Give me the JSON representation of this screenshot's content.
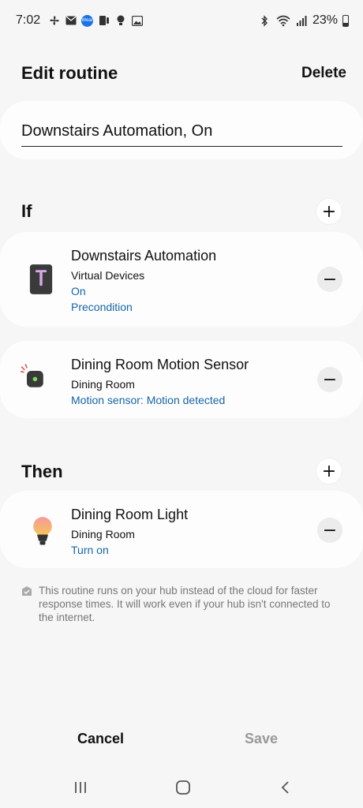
{
  "status_bar": {
    "time": "7:02",
    "battery": "23%",
    "wear_label": "Wear",
    "left_icons": [
      "fan-icon",
      "mail-icon",
      "wear-icon",
      "smartthings-icon",
      "bulb-icon",
      "image-icon"
    ],
    "right_icons": [
      "bluetooth-icon",
      "wifi-icon",
      "signal-icon",
      "battery-icon"
    ]
  },
  "header": {
    "title": "Edit routine",
    "delete_label": "Delete"
  },
  "routine_name": {
    "value": "Downstairs Automation, On"
  },
  "if_section": {
    "title": "If",
    "add_symbol": "+",
    "conditions": [
      {
        "title": "Downstairs Automation",
        "room": "Virtual Devices",
        "state": "On",
        "extra": "Precondition",
        "icon": "virtual-switch-icon",
        "remove_symbol": "−"
      },
      {
        "title": "Dining Room Motion Sensor",
        "room": "Dining Room",
        "state": "Motion sensor: Motion detected",
        "icon": "motion-sensor-icon",
        "remove_symbol": "−"
      }
    ]
  },
  "then_section": {
    "title": "Then",
    "add_symbol": "+",
    "actions": [
      {
        "title": "Dining Room Light",
        "room": "Dining Room",
        "state": "Turn on",
        "icon": "light-bulb-icon",
        "remove_symbol": "−"
      }
    ]
  },
  "info_note": "This routine runs on your hub instead of the cloud for faster response times. It will work even if your hub isn't connected to the internet.",
  "footer": {
    "cancel_label": "Cancel",
    "save_label": "Save"
  },
  "colors": {
    "background": "#f6f6f6",
    "card": "#fdfdfd",
    "link": "#1565a8",
    "muted": "#777777",
    "disabled": "#999999"
  }
}
